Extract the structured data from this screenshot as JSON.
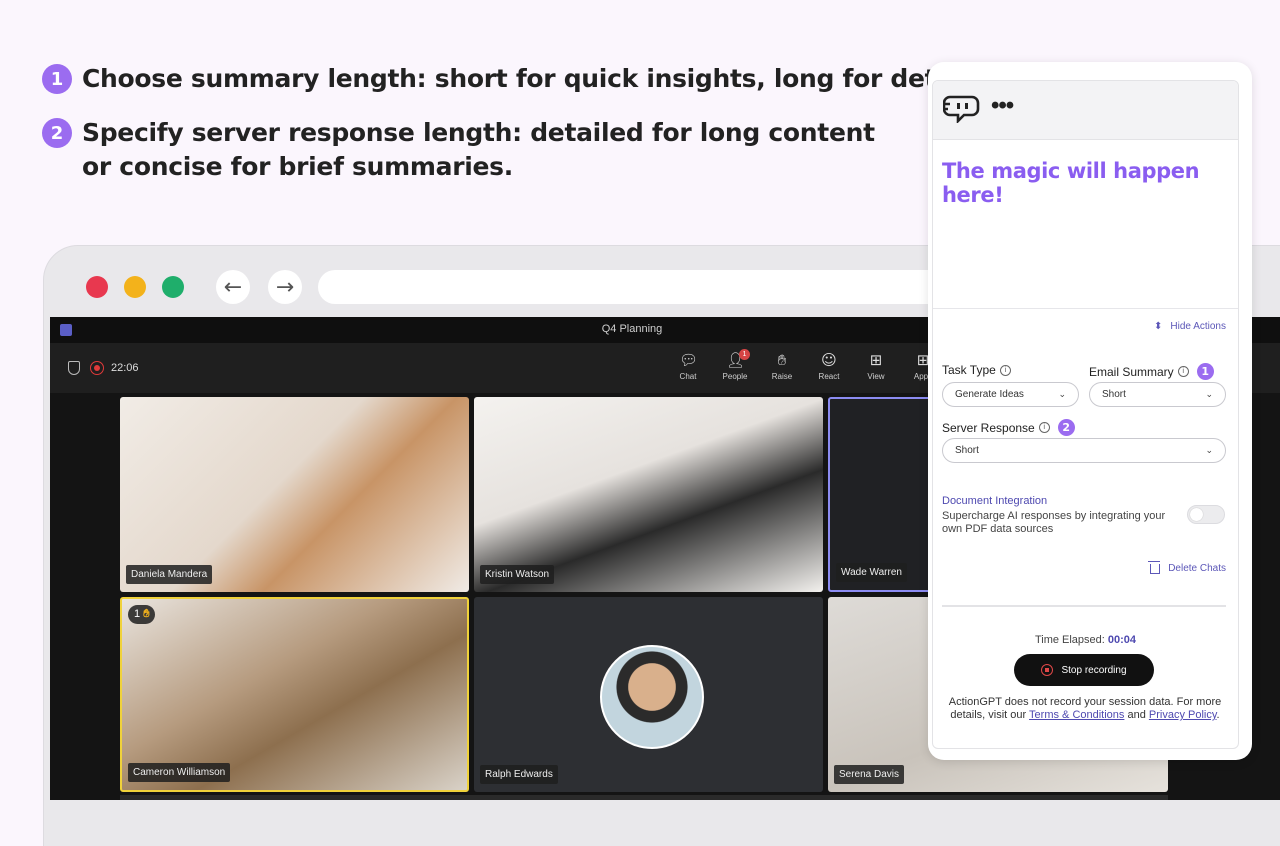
{
  "instructions": {
    "step1": {
      "number": "1",
      "text": "Choose summary length: short for quick insights, long for details."
    },
    "step2": {
      "number": "2",
      "line1": "Specify server response length: detailed for long content",
      "line2": "or concise for brief summaries."
    }
  },
  "browser": {
    "back_icon": "arrow-left-icon",
    "forward_icon": "arrow-right-icon"
  },
  "meeting": {
    "title": "Q4 Planning",
    "timer": "22:06",
    "toolbar": [
      {
        "label": "Chat",
        "icon": "chat-icon"
      },
      {
        "label": "People",
        "icon": "people-icon",
        "badge": "1"
      },
      {
        "label": "Raise",
        "icon": "hand-icon"
      },
      {
        "label": "React",
        "icon": "smile-icon"
      },
      {
        "label": "View",
        "icon": "grid-icon"
      },
      {
        "label": "Apps",
        "icon": "apps-icon"
      }
    ],
    "participants": [
      {
        "name": "Daniela Mandera"
      },
      {
        "name": "Kristin Watson"
      },
      {
        "name": "Wade Warren"
      },
      {
        "name": "Cameron Williamson",
        "raised_hand": "1"
      },
      {
        "name": "Ralph Edwards"
      },
      {
        "name": "Serena Davis"
      }
    ]
  },
  "panel": {
    "brand_icon": "actiongpt-logo-icon",
    "dots": "•••",
    "magic_text": "The magic will happen here!",
    "hide_actions": "Hide Actions",
    "task_type": {
      "label": "Task Type",
      "value": "Generate Ideas"
    },
    "email_summary": {
      "label": "Email Summary",
      "value": "Short",
      "step": "1"
    },
    "server_response": {
      "label": "Server Response",
      "value": "Short",
      "step": "2"
    },
    "doc_integration": {
      "title": "Document Integration",
      "description": "Supercharge AI responses by integrating your own PDF data sources",
      "enabled": false
    },
    "delete_chats": "Delete Chats",
    "time_elapsed_label": "Time Elapsed:",
    "time_elapsed_value": "00:04",
    "stop_recording": "Stop recording",
    "footer": {
      "text1": "ActionGPT does not record your session data. For more details, visit our ",
      "terms": "Terms & Conditions",
      "and": " and ",
      "privacy": "Privacy Policy",
      "end": "."
    },
    "accent_color": "#9b6cf0",
    "link_color": "#4e49b0"
  }
}
